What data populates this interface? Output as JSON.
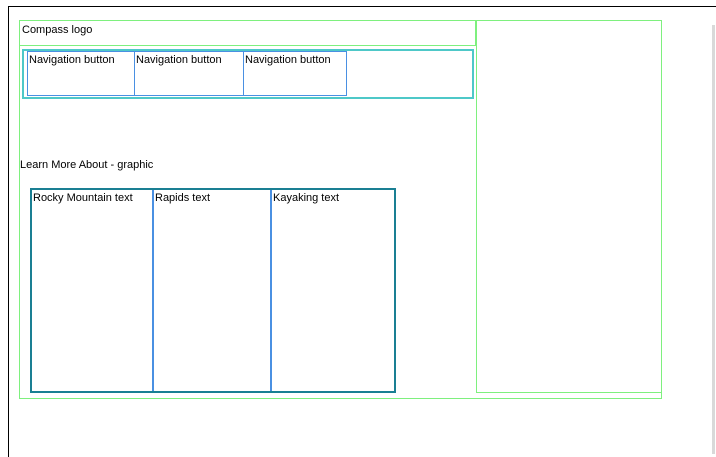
{
  "header": {
    "logo_label": "Compass logo"
  },
  "nav": {
    "buttons": [
      {
        "label": "Navigation button"
      },
      {
        "label": "Navigation button"
      },
      {
        "label": "Navigation button"
      }
    ]
  },
  "main": {
    "learn_more_label": "Learn More About - graphic",
    "columns": [
      {
        "label": "Rocky Mountain text"
      },
      {
        "label": "Rapids text"
      },
      {
        "label": "Kayaking text"
      }
    ]
  },
  "colors": {
    "layout_outline": "#7ef07e",
    "nav_outline": "#4ec8c8",
    "button_outline": "#4a90e2",
    "content_outline": "#1a7f93"
  }
}
